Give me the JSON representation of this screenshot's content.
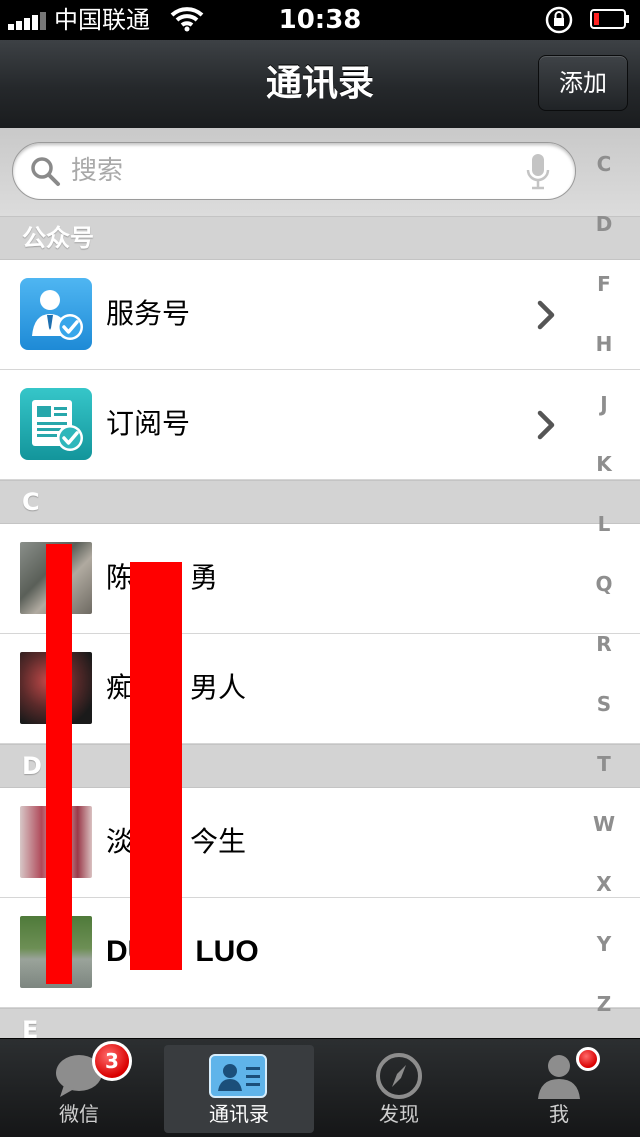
{
  "status_bar": {
    "carrier": "中国联通",
    "time": "10:38"
  },
  "nav": {
    "title": "通讯录",
    "add_label": "添加"
  },
  "search": {
    "placeholder": "搜索"
  },
  "sections": [
    {
      "header": "公众号"
    },
    {
      "header": "C"
    },
    {
      "header": "D"
    },
    {
      "header": "E"
    }
  ],
  "public_accounts": [
    {
      "name": "服务号"
    },
    {
      "name": "订阅号"
    }
  ],
  "contacts_c": [
    {
      "name": "陈",
      "name_tail": "勇"
    },
    {
      "name": "痴",
      "name_tail": "男人"
    }
  ],
  "contacts_d": [
    {
      "name": "淡",
      "name_tail": "今生"
    },
    {
      "name": "DU",
      "name_tail": "LUO"
    }
  ],
  "index": [
    "C",
    "D",
    "F",
    "H",
    "J",
    "K",
    "L",
    "Q",
    "R",
    "S",
    "T",
    "W",
    "X",
    "Y",
    "Z"
  ],
  "tabs": [
    {
      "label": "微信",
      "badge": "3"
    },
    {
      "label": "通讯录"
    },
    {
      "label": "发现"
    },
    {
      "label": "我"
    }
  ],
  "colors": {
    "accent_blue": "#2e9de6",
    "badge_red": "#d90000",
    "redaction": "#ff0000"
  }
}
